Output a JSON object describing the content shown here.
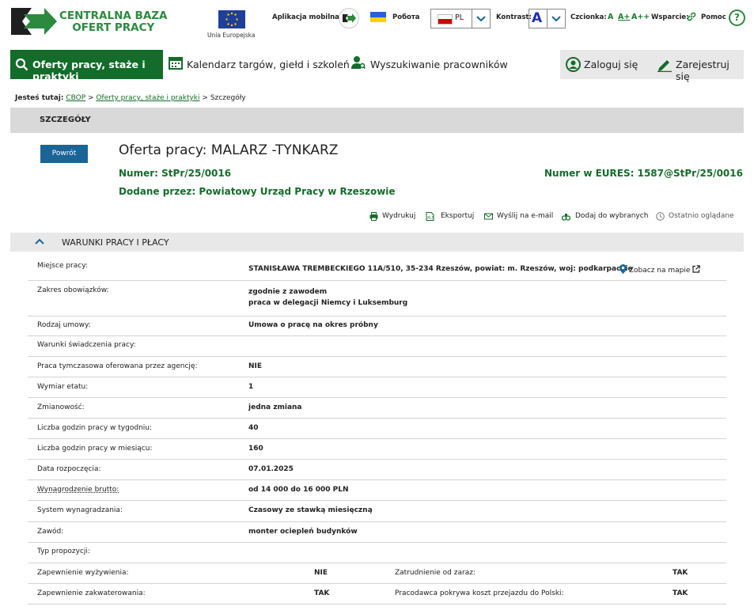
{
  "header": {
    "logo_line1": "CENTRALNA BAZA",
    "logo_line2": "OFERT PRACY",
    "eu_label": "Unia Europejska",
    "mobile_app": "Aplikacja mobilna",
    "ua_label": "Робота",
    "language": "PL",
    "contrast_label": "Kontrast:",
    "contrast_value": "A",
    "font_label": "Czcionka:",
    "font_sizes": [
      "A",
      "A+",
      "A++"
    ],
    "support_label": "Wsparcie:",
    "help_label": "Pomoc",
    "help_glyph": "?",
    "accent_color": "#146c2a"
  },
  "nav": {
    "offers": "Oferty pracy, staże i praktyki",
    "calendar": "Kalendarz targów, giełd i szkoleń",
    "search_workers": "Wyszukiwanie pracowników",
    "login": "Zaloguj się",
    "register": "Zarejestruj się"
  },
  "breadcrumb": {
    "prefix": "Jesteś tutaj:",
    "items": [
      "CBOP",
      "Oferty pracy, staże i praktyki",
      "Szczegóły"
    ],
    "sep": ">"
  },
  "section_title": "SZCZEGÓŁY",
  "back_button": "Powrót",
  "offer": {
    "title": "Oferta pracy: MALARZ -TYNKARZ",
    "number_label": "Numer:",
    "number": "StPr/25/0016",
    "eures_label": "Numer w EURES:",
    "eures": "1587@StPr/25/0016",
    "added_by_label": "Dodane przez:",
    "added_by": "Powiatowy Urząd Pracy w Rzeszowie"
  },
  "tools": [
    "Wydrukuj",
    "Eksportuj",
    "Wyślij na e-mail",
    "Dodaj do wybranych",
    "Ostatnio oglądane"
  ],
  "accordion_title": "WARUNKI PRACY I PŁACY",
  "map_link": "Zobacz na mapie",
  "details": [
    {
      "label": "Miejsce pracy:",
      "value": "STANISŁAWA TREMBECKIEGO 11A/510, 35-234 Rzeszów, powiat: m. Rzeszów, woj: podkarpackie"
    },
    {
      "label": "Zakres obowiązków:",
      "value": "zgodnie z zawodem",
      "value2": "praca w delegacji Niemcy i Luksemburg"
    },
    {
      "label": "Rodzaj umowy:",
      "value": "Umowa o pracę na okres próbny"
    },
    {
      "label": "Warunki świadczenia pracy:",
      "value": ""
    },
    {
      "label": "Praca tymczasowa oferowana przez agencję:",
      "value": "NIE"
    },
    {
      "label": "Wymiar etatu:",
      "value": "1"
    },
    {
      "label": "Zmianowość:",
      "value": "jedna zmiana"
    },
    {
      "label": "Liczba godzin pracy w tygodniu:",
      "value": "40"
    },
    {
      "label": "Liczba godzin pracy w miesiącu:",
      "value": "160"
    },
    {
      "label": "Data rozpoczęcia:",
      "value": "07.01.2025"
    },
    {
      "label": "Wynagrodzenie brutto:",
      "value": "od 14 000 do 16 000 PLN"
    },
    {
      "label": "System wynagradzania:",
      "value": "Czasowy ze stawką miesięczną"
    },
    {
      "label": "Zawód:",
      "value": "monter ociepleń budynków"
    },
    {
      "label": "Typ propozycji:",
      "value": ""
    }
  ],
  "extra_rows": [
    {
      "l1": "Zapewnienie wyżywienia:",
      "v1": "NIE",
      "l2": "Zatrudnienie od zaraz:",
      "v2": "TAK"
    },
    {
      "l1": "Zapewnienie zakwaterowania:",
      "v1": "TAK",
      "l2": "Pracodawca pokrywa koszt przejazdu do Polski:",
      "v2": "TAK"
    }
  ]
}
